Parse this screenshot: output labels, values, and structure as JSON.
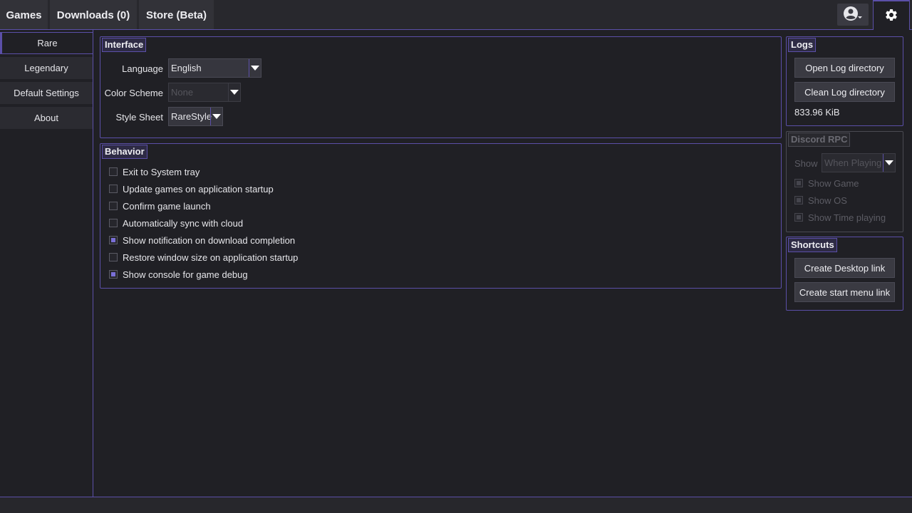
{
  "tabs": {
    "games": "Games",
    "downloads": "Downloads (0)",
    "store": "Store (Beta)"
  },
  "icons": {
    "account": "account-circle-icon",
    "settings": "gear-icon"
  },
  "sidebar": {
    "items": [
      {
        "label": "Rare",
        "active": true
      },
      {
        "label": "Legendary",
        "active": false
      },
      {
        "label": "Default Settings",
        "active": false
      },
      {
        "label": "About",
        "active": false
      }
    ]
  },
  "interface": {
    "title": "Interface",
    "language_label": "Language",
    "language_value": "English",
    "color_scheme_label": "Color Scheme",
    "color_scheme_value": "None",
    "style_sheet_label": "Style Sheet",
    "style_sheet_value": "RareStyle"
  },
  "behavior": {
    "title": "Behavior",
    "options": [
      {
        "label": "Exit to System tray",
        "checked": false
      },
      {
        "label": "Update games on application startup",
        "checked": false
      },
      {
        "label": "Confirm game launch",
        "checked": false
      },
      {
        "label": "Automatically sync with cloud",
        "checked": false
      },
      {
        "label": "Show notification on download completion",
        "checked": true
      },
      {
        "label": "Restore window size on application startup",
        "checked": false
      },
      {
        "label": "Show console for game debug",
        "checked": true
      }
    ]
  },
  "logs": {
    "title": "Logs",
    "open_button": "Open Log directory",
    "clean_button": "Clean Log directory",
    "size": "833.96 KiB"
  },
  "discord": {
    "title": "Discord RPC",
    "show_label": "Show",
    "show_value": "When Playing",
    "options": [
      {
        "label": "Show Game"
      },
      {
        "label": "Show OS"
      },
      {
        "label": "Show Time playing"
      }
    ]
  },
  "shortcuts": {
    "title": "Shortcuts",
    "desktop_button": "Create Desktop link",
    "start_menu_button": "Create start menu link"
  },
  "colors": {
    "accent": "#5b4fa8",
    "background": "#202025",
    "check_fill": "#7a6fd6"
  }
}
